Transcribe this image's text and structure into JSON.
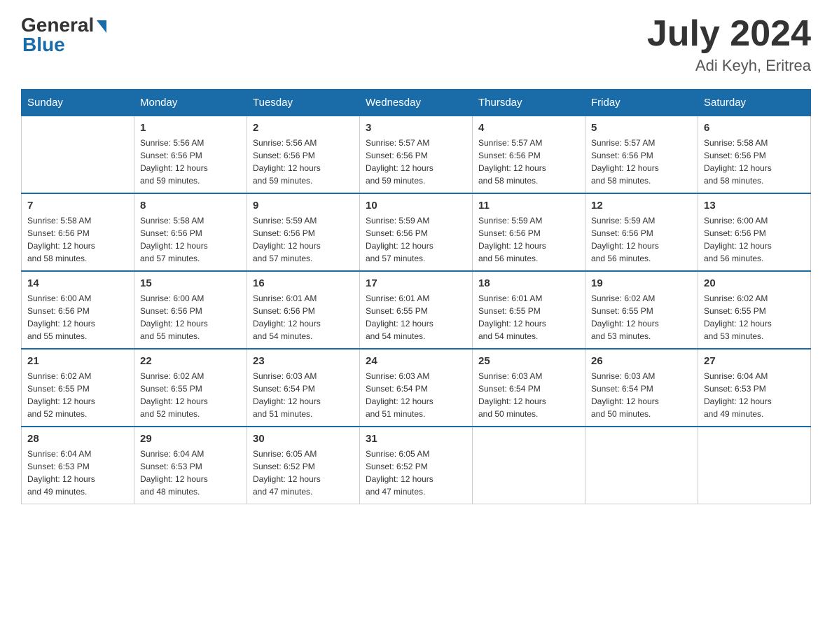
{
  "header": {
    "logo_general": "General",
    "logo_blue": "Blue",
    "month_year": "July 2024",
    "location": "Adi Keyh, Eritrea"
  },
  "weekdays": [
    "Sunday",
    "Monday",
    "Tuesday",
    "Wednesday",
    "Thursday",
    "Friday",
    "Saturday"
  ],
  "weeks": [
    [
      {
        "day": "",
        "info": ""
      },
      {
        "day": "1",
        "info": "Sunrise: 5:56 AM\nSunset: 6:56 PM\nDaylight: 12 hours\nand 59 minutes."
      },
      {
        "day": "2",
        "info": "Sunrise: 5:56 AM\nSunset: 6:56 PM\nDaylight: 12 hours\nand 59 minutes."
      },
      {
        "day": "3",
        "info": "Sunrise: 5:57 AM\nSunset: 6:56 PM\nDaylight: 12 hours\nand 59 minutes."
      },
      {
        "day": "4",
        "info": "Sunrise: 5:57 AM\nSunset: 6:56 PM\nDaylight: 12 hours\nand 58 minutes."
      },
      {
        "day": "5",
        "info": "Sunrise: 5:57 AM\nSunset: 6:56 PM\nDaylight: 12 hours\nand 58 minutes."
      },
      {
        "day": "6",
        "info": "Sunrise: 5:58 AM\nSunset: 6:56 PM\nDaylight: 12 hours\nand 58 minutes."
      }
    ],
    [
      {
        "day": "7",
        "info": "Sunrise: 5:58 AM\nSunset: 6:56 PM\nDaylight: 12 hours\nand 58 minutes."
      },
      {
        "day": "8",
        "info": "Sunrise: 5:58 AM\nSunset: 6:56 PM\nDaylight: 12 hours\nand 57 minutes."
      },
      {
        "day": "9",
        "info": "Sunrise: 5:59 AM\nSunset: 6:56 PM\nDaylight: 12 hours\nand 57 minutes."
      },
      {
        "day": "10",
        "info": "Sunrise: 5:59 AM\nSunset: 6:56 PM\nDaylight: 12 hours\nand 57 minutes."
      },
      {
        "day": "11",
        "info": "Sunrise: 5:59 AM\nSunset: 6:56 PM\nDaylight: 12 hours\nand 56 minutes."
      },
      {
        "day": "12",
        "info": "Sunrise: 5:59 AM\nSunset: 6:56 PM\nDaylight: 12 hours\nand 56 minutes."
      },
      {
        "day": "13",
        "info": "Sunrise: 6:00 AM\nSunset: 6:56 PM\nDaylight: 12 hours\nand 56 minutes."
      }
    ],
    [
      {
        "day": "14",
        "info": "Sunrise: 6:00 AM\nSunset: 6:56 PM\nDaylight: 12 hours\nand 55 minutes."
      },
      {
        "day": "15",
        "info": "Sunrise: 6:00 AM\nSunset: 6:56 PM\nDaylight: 12 hours\nand 55 minutes."
      },
      {
        "day": "16",
        "info": "Sunrise: 6:01 AM\nSunset: 6:56 PM\nDaylight: 12 hours\nand 54 minutes."
      },
      {
        "day": "17",
        "info": "Sunrise: 6:01 AM\nSunset: 6:55 PM\nDaylight: 12 hours\nand 54 minutes."
      },
      {
        "day": "18",
        "info": "Sunrise: 6:01 AM\nSunset: 6:55 PM\nDaylight: 12 hours\nand 54 minutes."
      },
      {
        "day": "19",
        "info": "Sunrise: 6:02 AM\nSunset: 6:55 PM\nDaylight: 12 hours\nand 53 minutes."
      },
      {
        "day": "20",
        "info": "Sunrise: 6:02 AM\nSunset: 6:55 PM\nDaylight: 12 hours\nand 53 minutes."
      }
    ],
    [
      {
        "day": "21",
        "info": "Sunrise: 6:02 AM\nSunset: 6:55 PM\nDaylight: 12 hours\nand 52 minutes."
      },
      {
        "day": "22",
        "info": "Sunrise: 6:02 AM\nSunset: 6:55 PM\nDaylight: 12 hours\nand 52 minutes."
      },
      {
        "day": "23",
        "info": "Sunrise: 6:03 AM\nSunset: 6:54 PM\nDaylight: 12 hours\nand 51 minutes."
      },
      {
        "day": "24",
        "info": "Sunrise: 6:03 AM\nSunset: 6:54 PM\nDaylight: 12 hours\nand 51 minutes."
      },
      {
        "day": "25",
        "info": "Sunrise: 6:03 AM\nSunset: 6:54 PM\nDaylight: 12 hours\nand 50 minutes."
      },
      {
        "day": "26",
        "info": "Sunrise: 6:03 AM\nSunset: 6:54 PM\nDaylight: 12 hours\nand 50 minutes."
      },
      {
        "day": "27",
        "info": "Sunrise: 6:04 AM\nSunset: 6:53 PM\nDaylight: 12 hours\nand 49 minutes."
      }
    ],
    [
      {
        "day": "28",
        "info": "Sunrise: 6:04 AM\nSunset: 6:53 PM\nDaylight: 12 hours\nand 49 minutes."
      },
      {
        "day": "29",
        "info": "Sunrise: 6:04 AM\nSunset: 6:53 PM\nDaylight: 12 hours\nand 48 minutes."
      },
      {
        "day": "30",
        "info": "Sunrise: 6:05 AM\nSunset: 6:52 PM\nDaylight: 12 hours\nand 47 minutes."
      },
      {
        "day": "31",
        "info": "Sunrise: 6:05 AM\nSunset: 6:52 PM\nDaylight: 12 hours\nand 47 minutes."
      },
      {
        "day": "",
        "info": ""
      },
      {
        "day": "",
        "info": ""
      },
      {
        "day": "",
        "info": ""
      }
    ]
  ]
}
